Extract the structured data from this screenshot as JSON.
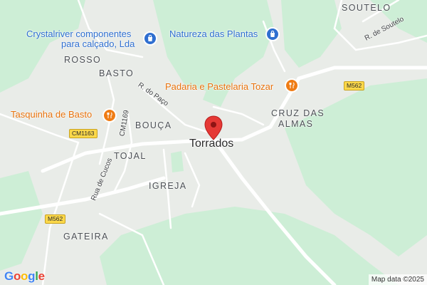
{
  "map": {
    "place_name": "Torrados",
    "areas": {
      "soutelo": "SOUTELO",
      "rosso": "ROSSO",
      "basto": "BASTO",
      "bouca": "BOUÇA",
      "tojal": "TOJAL",
      "igreja": "IGREJA",
      "gateira": "GATEIRA",
      "cruz_line1": "CRUZ DAS",
      "cruz_line2": "ALMAS"
    },
    "streets": {
      "r_soutelo": "R. de Soutelo",
      "r_paco": "R. do Paço",
      "cm1169": "CM1169",
      "rua_cucos": "Rua de Cucos"
    },
    "shields": {
      "m562_top": "M562",
      "cm1163": "CM1163",
      "m562_left": "M562"
    },
    "pois": [
      {
        "name_line1": "Crystalriver componentes",
        "name_line2": "para calçado, Lda",
        "icon": "shopping-bag-icon",
        "color": "#2f6fd0"
      },
      {
        "name_line1": "Natureza das Plantas",
        "icon": "shopping-bag-icon",
        "color": "#2f6fd0"
      },
      {
        "name_line1": "Padaria e Pastelaria Tozar",
        "icon": "restaurant-icon",
        "color": "#ef7c14"
      },
      {
        "name_line1": "Tasquinha de Basto",
        "icon": "restaurant-icon",
        "color": "#ef7c14"
      }
    ],
    "pin_color": "#e53935",
    "attribution": "Map data ©2025",
    "logo": "Google"
  }
}
